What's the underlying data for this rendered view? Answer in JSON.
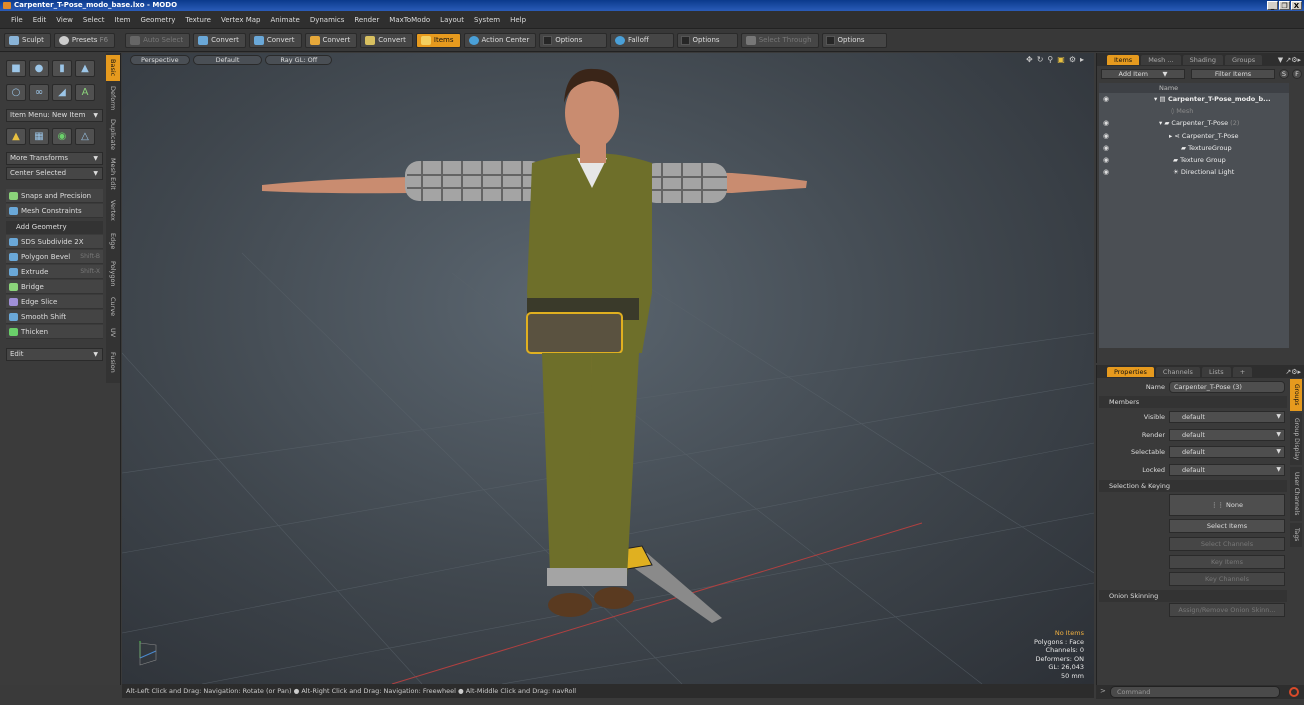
{
  "window": {
    "title": "Carpenter_T-Pose_modo_base.lxo - MODO",
    "buttons": [
      "_",
      "❐",
      "X"
    ]
  },
  "menu": [
    "File",
    "Edit",
    "View",
    "Select",
    "Item",
    "Geometry",
    "Texture",
    "Vertex Map",
    "Animate",
    "Dynamics",
    "Render",
    "MaxToModo",
    "Layout",
    "System",
    "Help"
  ],
  "toolbar": {
    "sculpt": "Sculpt",
    "presets": "Presets",
    "presets_key": "F6",
    "auto_select": "Auto Select",
    "convert1": "Convert",
    "convert2": "Convert",
    "convert3": "Convert",
    "convert4": "Convert",
    "items": "Items",
    "action_center": "Action Center",
    "options1": "Options",
    "falloff": "Falloff",
    "options2": "Options",
    "select_through": "Select Through",
    "options3": "Options"
  },
  "left": {
    "item_menu": "Item Menu: New Item",
    "more_transforms": "More Transforms",
    "center_selected": "Center Selected",
    "snaps": "Snaps and Precision",
    "mesh_constraints": "Mesh Constraints",
    "add_geometry": "Add Geometry",
    "tools": [
      {
        "label": "SDS Subdivide 2X",
        "shortcut": ""
      },
      {
        "label": "Polygon Bevel",
        "shortcut": "Shift-B"
      },
      {
        "label": "Extrude",
        "shortcut": "Shift-X"
      },
      {
        "label": "Bridge",
        "shortcut": ""
      },
      {
        "label": "Edge Slice",
        "shortcut": ""
      },
      {
        "label": "Smooth Shift",
        "shortcut": ""
      },
      {
        "label": "Thicken",
        "shortcut": ""
      }
    ],
    "edit": "Edit",
    "vtabs": [
      "Basic",
      "Deform",
      "Duplicate",
      "Mesh Edit",
      "Vertex",
      "Edge",
      "Polygon",
      "Curve",
      "UV",
      "Fusion"
    ]
  },
  "viewport": {
    "view": "Perspective",
    "shading": "Default",
    "raygl": "Ray GL: Off",
    "info": {
      "no_items": "No Items",
      "polygons": "Polygons : Face",
      "channels": "Channels: 0",
      "deformers": "Deformers: ON",
      "gl": "GL: 26,043",
      "scale": "50 mm"
    }
  },
  "status": "Alt-Left Click and Drag: Navigation: Rotate (or Pan) ● Alt-Right Click and Drag: Navigation: Freewheel ● Alt-Middle Click and Drag: navRoll",
  "items_panel": {
    "tabs": [
      "Items",
      "Mesh ...",
      "Shading",
      "Groups"
    ],
    "add_item": "Add Item",
    "filter_items": "Filter Items",
    "s": "S",
    "f": "F",
    "name_col": "Name",
    "rows": [
      {
        "label": "Carpenter_T-Pose_modo_b...",
        "count": ""
      },
      {
        "label": "Mesh",
        "count": ""
      },
      {
        "label": "Carpenter_T-Pose",
        "count": "(2)"
      },
      {
        "label": "Carpenter_T-Pose",
        "count": ""
      },
      {
        "label": "TextureGroup",
        "count": ""
      },
      {
        "label": "Texture Group",
        "count": ""
      },
      {
        "label": "Directional Light",
        "count": ""
      }
    ]
  },
  "properties": {
    "tabs": [
      "Properties",
      "Channels",
      "Lists",
      "+"
    ],
    "name_label": "Name",
    "name_value": "Carpenter_T-Pose (3)",
    "members": "Members",
    "fields": [
      {
        "label": "Visible",
        "value": "default"
      },
      {
        "label": "Render",
        "value": "default"
      },
      {
        "label": "Selectable",
        "value": "default"
      },
      {
        "label": "Locked",
        "value": "default"
      }
    ],
    "selection_keying": "Selection & Keying",
    "none": "None",
    "select_items": "Select Items",
    "select_channels": "Select Channels",
    "key_items": "Key Items",
    "key_channels": "Key Channels",
    "onion": "Onion Skinning",
    "assign_onion": "Assign/Remove Onion Skinn...",
    "vtabs": [
      "Groups",
      "Group Display",
      "User Channels",
      "Tags"
    ]
  },
  "command": {
    "placeholder": "Command"
  }
}
